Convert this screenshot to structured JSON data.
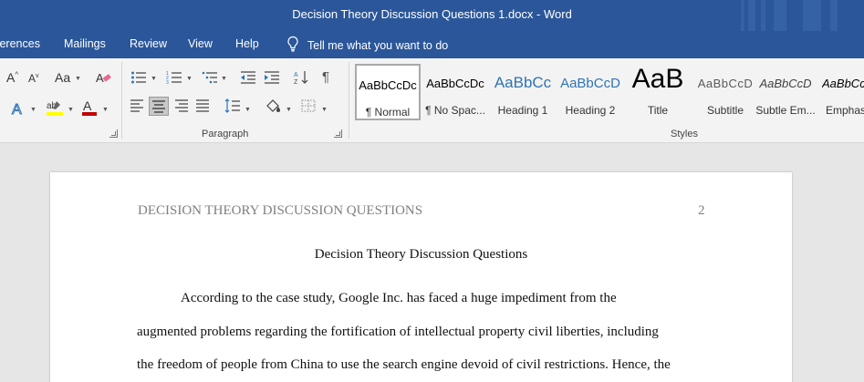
{
  "window": {
    "title": "Decision Theory Discussion Questions 1.docx  -  Word"
  },
  "menu": {
    "tabs": [
      "ferences",
      "Mailings",
      "Review",
      "View",
      "Help"
    ],
    "tell_me": "Tell me what you want to do"
  },
  "ribbon": {
    "paragraph_label": "Paragraph",
    "styles_label": "Styles",
    "styles": [
      {
        "sample": "AaBbCcDc",
        "name": "¶ Normal"
      },
      {
        "sample": "AaBbCcDc",
        "name": "¶ No Spac..."
      },
      {
        "sample": "AaBbCc",
        "name": "Heading 1"
      },
      {
        "sample": "AaBbCcD",
        "name": "Heading 2"
      },
      {
        "sample": "AaB",
        "name": "Title"
      },
      {
        "sample": "AaBbCcD",
        "name": "Subtitle"
      },
      {
        "sample": "AaBbCcD",
        "name": "Subtle Em..."
      },
      {
        "sample": "AaBbCc",
        "name": "Emphas"
      }
    ],
    "colors": {
      "highlight": "#ffff00",
      "font_color": "#c00000"
    }
  },
  "document": {
    "header_text": "DECISION THEORY DISCUSSION QUESTIONS",
    "page_number": "2",
    "title": "Decision Theory Discussion Questions",
    "lines": [
      "According to the case study, Google Inc. has faced a huge impediment from the",
      "augmented problems regarding the fortification of intellectual property civil liberties, including",
      "the freedom of people from China to use the search engine devoid of civil restrictions. Hence, the"
    ]
  }
}
